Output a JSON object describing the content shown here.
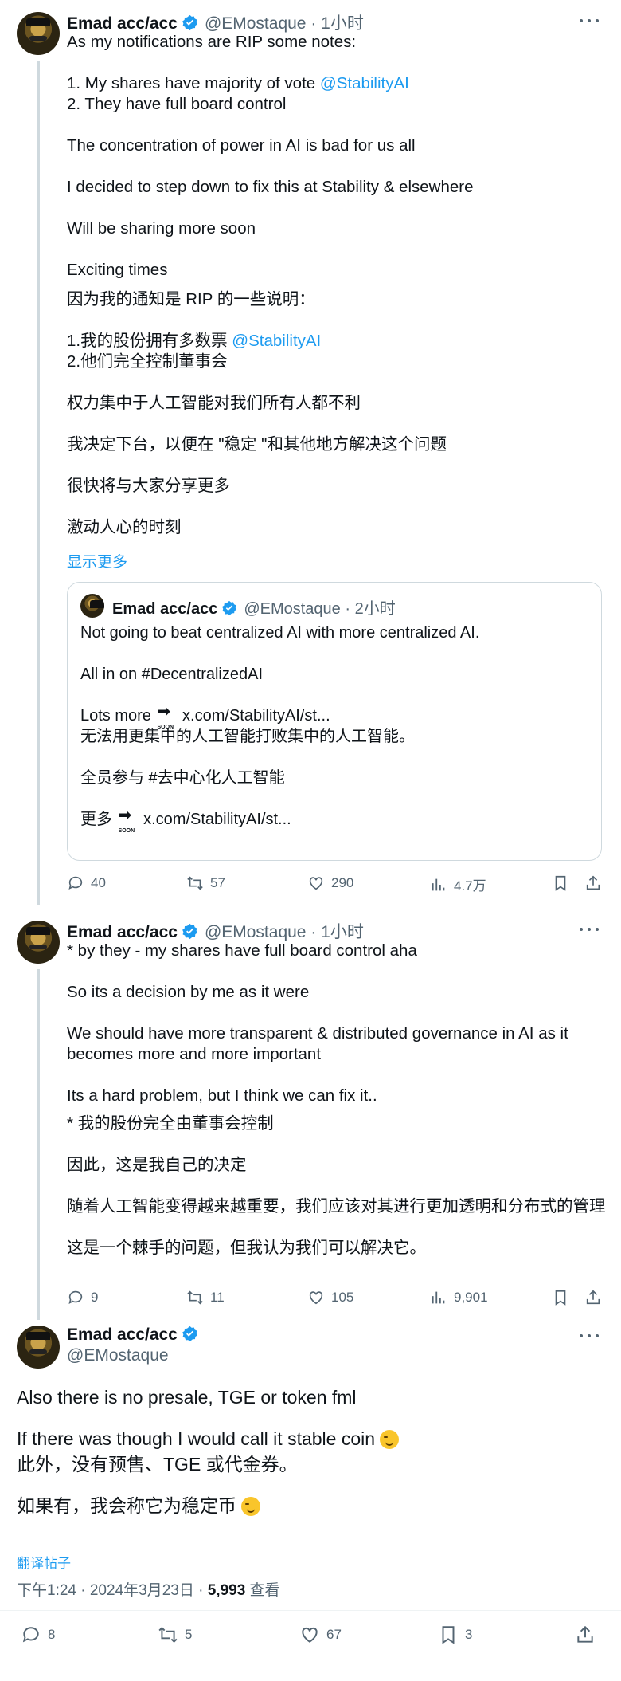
{
  "tweets": [
    {
      "name": "Emad acc/acc",
      "handle": "@EMostaque",
      "time": "· 1小时",
      "body": "As my notifications are RIP some notes:\n\n1. My shares have majority of vote ",
      "mention1": "@StabilityAI",
      "body2": "\n2. They have full board control\n\nThe concentration of power in AI is bad for us all\n\nI decided to step down to fix this at Stability & elsewhere\n\nWill be sharing more soon\n\nExciting times",
      "translation": "因为我的通知是 RIP 的一些说明：\n\n1.我的股份拥有多数票 ",
      "translation_mention": "@StabilityAI",
      "translation2": "\n2.他们完全控制董事会\n\n权力集中于人工智能对我们所有人都不利\n\n我决定下台，以便在 \"稳定 \"和其他地方解决这个问题\n\n很快将与大家分享更多\n\n激动人心的时刻",
      "show_more": "显示更多",
      "quote": {
        "name": "Emad acc/acc",
        "handle": "@EMostaque",
        "time": "· 2小时",
        "line1": "Not going to beat centralized AI with more centralized AI.",
        "line2": "All in on #DecentralizedAI",
        "line3a": "Lots more ",
        "line3b": " x.com/StabilityAI/st...",
        "line4": "无法用更集中的人工智能打败集中的人工智能。",
        "line5": "全员参与 #去中心化人工智能",
        "line6a": "更多 ",
        "line6b": " x.com/StabilityAI/st..."
      },
      "replies": "40",
      "retweets": "57",
      "likes": "290",
      "views": "4.7万"
    },
    {
      "name": "Emad acc/acc",
      "handle": "@EMostaque",
      "time": "· 1小时",
      "body": "* by they - my shares have full board control aha\n\nSo its a decision by me as it were\n\nWe should have more transparent & distributed governance in AI as it\nbecomes more and more important\n\nIts a hard problem, but I think we can fix it..",
      "translation": "* 我的股份完全由董事会控制\n\n因此，这是我自己的决定\n\n随着人工智能变得越来越重要，我们应该对其进行更加透明和分布式的管理\n\n这是一个棘手的问题，但我认为我们可以解决它。",
      "replies": "9",
      "retweets": "11",
      "likes": "105",
      "views": "9,901"
    },
    {
      "name": "Emad acc/acc",
      "handle": "@EMostaque",
      "line1": "Also there is no presale, TGE or token fml",
      "line2": "If there was though I would call it stable coin ",
      "line3": "此外，没有预售、TGE 或代金券。",
      "line4": "如果有，我会称它为稳定币 ",
      "translate_link": "翻译帖子",
      "meta_time": "下午1:24 · 2024年3月23日 · ",
      "meta_views": "5,993",
      "meta_views_label": " 查看",
      "replies": "8",
      "retweets": "5",
      "likes": "67",
      "bookmarks": "3"
    }
  ],
  "icons": [
    "verified-badge-icon",
    "more-icon",
    "reply-icon",
    "retweet-icon",
    "like-icon",
    "views-icon",
    "bookmark-icon",
    "share-icon",
    "soon-arrow-icon",
    "smirk-emoji-icon"
  ],
  "colors": {
    "accent": "#1d9bf0",
    "secondary_text": "#536471",
    "border": "#cfd9de"
  }
}
